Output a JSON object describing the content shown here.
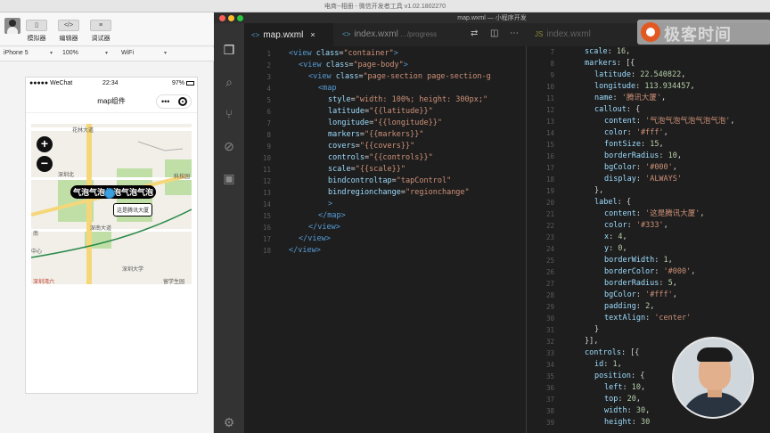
{
  "devtools": {
    "title": "电商--相册 - 微信开发者工具 v1.02.1802270",
    "tools": [
      {
        "label": "模拟器",
        "glyph": "▯"
      },
      {
        "label": "编辑器",
        "glyph": "</>"
      },
      {
        "label": "调试器",
        "glyph": "≡"
      }
    ],
    "device": "iPhone 5",
    "zoom": "100%",
    "network": "WiFi"
  },
  "phone": {
    "carrier": "●●●●● WeChat",
    "time": "22:34",
    "battery": "97%",
    "nav_title": "map组件",
    "capsule_dots": "•••"
  },
  "map": {
    "zoom_in": "+",
    "zoom_out": "−",
    "callout": "气泡气泡气泡气泡气泡",
    "label": "这是腾讯大厦",
    "places": [
      "花林大道",
      "深圳北",
      "深南大道",
      "腾讯大厦",
      "中心",
      "深圳大学",
      "深圳湾六",
      "留学生园",
      "科技园",
      "南"
    ]
  },
  "editor": {
    "window_title": "map.wxml — 小程序开发",
    "tabs": [
      {
        "ext": "<>",
        "name": "map.wxml",
        "close": "×",
        "path": ""
      },
      {
        "ext": "<>",
        "name": "index.wxml",
        "close": "",
        "path": "…/progress"
      },
      {
        "ext": "JS",
        "name": "index.wxml",
        "close": "",
        "path": ""
      }
    ],
    "pane1_lines": [
      {
        "n": "1",
        "html": "<span class=\"tag\">&lt;view</span> <span class=\"attr\">class</span>=<span class=\"str\">\"container\"</span><span class=\"tag\">&gt;</span>",
        "indent": 0
      },
      {
        "n": "2",
        "html": "<span class=\"tag\">&lt;view</span> <span class=\"attr\">class</span>=<span class=\"str\">\"page-body\"</span><span class=\"tag\">&gt;</span>",
        "indent": 1
      },
      {
        "n": "3",
        "html": "<span class=\"tag\">&lt;view</span> <span class=\"attr\">class</span>=<span class=\"str\">\"page-section page-section-g</span>",
        "indent": 2
      },
      {
        "n": "4",
        "html": "<span class=\"tag\">&lt;map</span>",
        "indent": 3
      },
      {
        "n": "5",
        "html": "<span class=\"attr\">style</span>=<span class=\"str\">\"width: 100%; height: 300px;\"</span>",
        "indent": 4
      },
      {
        "n": "6",
        "html": "<span class=\"attr\">latitude</span>=<span class=\"str\">\"{{latitude}}\"</span>",
        "indent": 4
      },
      {
        "n": "7",
        "html": "<span class=\"attr\">longitude</span>=<span class=\"str\">\"{{longitude}}\"</span>",
        "indent": 4
      },
      {
        "n": "8",
        "html": "<span class=\"attr\">markers</span>=<span class=\"str\">\"{{markers}}\"</span>",
        "indent": 4
      },
      {
        "n": "9",
        "html": "<span class=\"attr\">covers</span>=<span class=\"str\">\"{{covers}}\"</span>",
        "indent": 4
      },
      {
        "n": "10",
        "html": "<span class=\"attr\">controls</span>=<span class=\"str\">\"{{controls}}\"</span>",
        "indent": 4
      },
      {
        "n": "11",
        "html": "<span class=\"attr\">scale</span>=<span class=\"str\">\"{{scale}}\"</span>",
        "indent": 4
      },
      {
        "n": "12",
        "html": "<span class=\"attr\">bindcontroltap</span>=<span class=\"str\">\"tapControl\"</span>",
        "indent": 4
      },
      {
        "n": "13",
        "html": "<span class=\"attr\">bindregionchange</span>=<span class=\"str\">\"regionchange\"</span>",
        "indent": 4
      },
      {
        "n": "14",
        "html": "<span class=\"tag\">&gt;</span>",
        "indent": 4
      },
      {
        "n": "15",
        "html": "<span class=\"tag\">&lt;/map&gt;</span>",
        "indent": 3
      },
      {
        "n": "16",
        "html": "<span class=\"tag\">&lt;/view&gt;</span>",
        "indent": 2
      },
      {
        "n": "17",
        "html": "<span class=\"tag\">&lt;/view&gt;</span>",
        "indent": 1
      },
      {
        "n": "18",
        "html": "<span class=\"tag\">&lt;/view&gt;</span>",
        "indent": 0
      }
    ],
    "pane2_lines": [
      {
        "n": "7",
        "html": "<span class=\"key\">scale</span>: <span class=\"num\">16</span>,",
        "indent": 0
      },
      {
        "n": "8",
        "html": "<span class=\"key\">markers</span>: [{",
        "indent": 0
      },
      {
        "n": "9",
        "html": "<span class=\"key\">latitude</span>: <span class=\"num\">22.540822</span>,",
        "indent": 1
      },
      {
        "n": "10",
        "html": "<span class=\"key\">longitude</span>: <span class=\"num\">113.934457</span>,",
        "indent": 1
      },
      {
        "n": "11",
        "html": "<span class=\"key\">name</span>: <span class=\"str\">'腾讯大厦'</span>,",
        "indent": 1
      },
      {
        "n": "12",
        "html": "<span class=\"key\">callout</span>: {",
        "indent": 1
      },
      {
        "n": "13",
        "html": "<span class=\"key\">content</span>: <span class=\"str\">'气泡气泡气泡气泡气泡'</span>,",
        "indent": 2
      },
      {
        "n": "14",
        "html": "<span class=\"key\">color</span>: <span class=\"str\">'#fff'</span>,",
        "indent": 2
      },
      {
        "n": "15",
        "html": "<span class=\"key\">fontSize</span>: <span class=\"num\">15</span>,",
        "indent": 2
      },
      {
        "n": "16",
        "html": "<span class=\"key\">borderRadius</span>: <span class=\"num\">10</span>,",
        "indent": 2
      },
      {
        "n": "17",
        "html": "<span class=\"key\">bgColor</span>: <span class=\"str\">'#000'</span>,",
        "indent": 2
      },
      {
        "n": "18",
        "html": "<span class=\"key\">display</span>: <span class=\"str\">'ALWAYS'</span>",
        "indent": 2
      },
      {
        "n": "19",
        "html": "},",
        "indent": 1
      },
      {
        "n": "20",
        "html": "<span class=\"key\">label</span>: {",
        "indent": 1
      },
      {
        "n": "21",
        "html": "<span class=\"key\">content</span>: <span class=\"str\">'这是腾讯大厦'</span>,",
        "indent": 2
      },
      {
        "n": "22",
        "html": "<span class=\"key\">color</span>: <span class=\"str\">'#333'</span>,",
        "indent": 2
      },
      {
        "n": "23",
        "html": "<span class=\"key\">x</span>: <span class=\"num\">4</span>,",
        "indent": 2
      },
      {
        "n": "24",
        "html": "<span class=\"key\">y</span>: <span class=\"num\">0</span>,",
        "indent": 2
      },
      {
        "n": "25",
        "html": "<span class=\"key\">borderWidth</span>: <span class=\"num\">1</span>,",
        "indent": 2
      },
      {
        "n": "26",
        "html": "<span class=\"key\">borderColor</span>: <span class=\"str\">'#000'</span>,",
        "indent": 2
      },
      {
        "n": "27",
        "html": "<span class=\"key\">borderRadius</span>: <span class=\"num\">5</span>,",
        "indent": 2
      },
      {
        "n": "28",
        "html": "<span class=\"key\">bgColor</span>: <span class=\"str\">'#fff'</span>,",
        "indent": 2
      },
      {
        "n": "29",
        "html": "<span class=\"key\">padding</span>: <span class=\"num\">2</span>,",
        "indent": 2
      },
      {
        "n": "30",
        "html": "<span class=\"key\">textAlign</span>: <span class=\"str\">'center'</span>",
        "indent": 2
      },
      {
        "n": "31",
        "html": "}",
        "indent": 1
      },
      {
        "n": "32",
        "html": "}],",
        "indent": 0
      },
      {
        "n": "33",
        "html": "<span class=\"key\">controls</span>: [{",
        "indent": 0
      },
      {
        "n": "34",
        "html": "<span class=\"key\">id</span>: <span class=\"num\">1</span>,",
        "indent": 1
      },
      {
        "n": "35",
        "html": "<span class=\"key\">position</span>: {",
        "indent": 1
      },
      {
        "n": "36",
        "html": "<span class=\"key\">left</span>: <span class=\"num\">10</span>,",
        "indent": 2
      },
      {
        "n": "37",
        "html": "<span class=\"key\">top</span>: <span class=\"num\">20</span>,",
        "indent": 2
      },
      {
        "n": "38",
        "html": "<span class=\"key\">width</span>: <span class=\"num\">30</span>,",
        "indent": 2
      },
      {
        "n": "39",
        "html": "<span class=\"key\">height</span>: <span class=\"num\">30</span>",
        "indent": 2
      }
    ]
  },
  "logo": {
    "text": "极客时间"
  },
  "colors": {
    "accent_logo": "#e25822",
    "callout_bg": "#000000",
    "marker": "#3aa0e0",
    "editor_bg": "#1e1e1e"
  }
}
